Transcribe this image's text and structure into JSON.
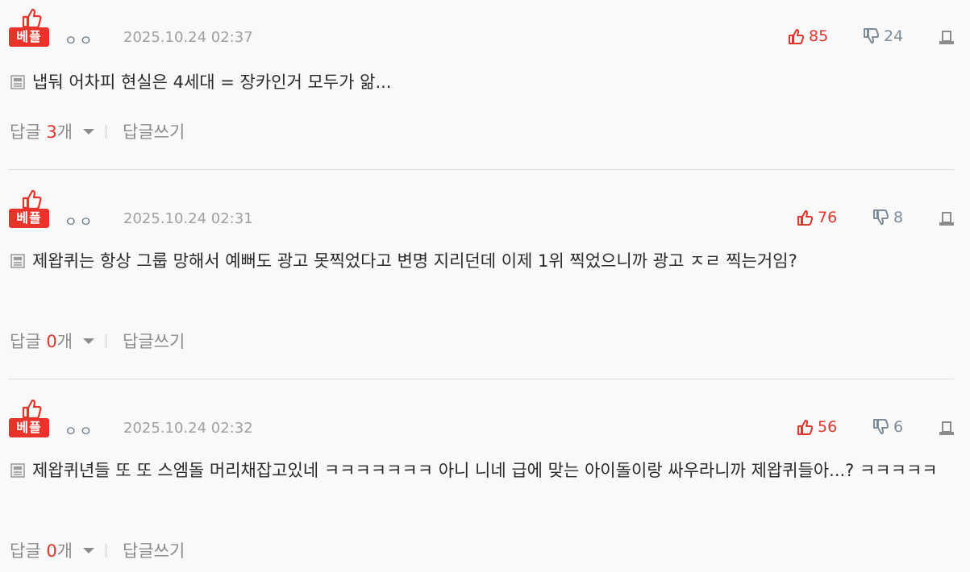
{
  "comments": [
    {
      "badge": "베플",
      "author": "ㅇㅇ",
      "date": "2025.10.24 02:37",
      "likes": "85",
      "dislikes": "24",
      "text": "냅둬 어차피 현실은 4세대 = 장카인거 모두가 앎...",
      "reply_label": "답글",
      "reply_count": "3",
      "reply_unit": "개",
      "write_reply": "답글쓰기"
    },
    {
      "badge": "베플",
      "author": "ㅇㅇ",
      "date": "2025.10.24 02:31",
      "likes": "76",
      "dislikes": "8",
      "text": "제왑퀴는 항상 그룹 망해서 예뻐도 광고 못찍었다고 변명 지리던데 이제 1위 찍었으니까 광고 ㅈㄹ 찍는거임?",
      "reply_label": "답글",
      "reply_count": "0",
      "reply_unit": "개",
      "write_reply": "답글쓰기"
    },
    {
      "badge": "베플",
      "author": "ㅇㅇ",
      "date": "2025.10.24 02:32",
      "likes": "56",
      "dislikes": "6",
      "text": "제왑퀴년들 또 또 스엠돌 머리채잡고있네 ㅋㅋㅋㅋㅋㅋㅋ 아니 니네 급에 맞는 아이돌이랑 싸우라니까 제왑퀴들아...? ㅋㅋㅋㅋㅋ",
      "reply_label": "답글",
      "reply_count": "0",
      "reply_unit": "개",
      "write_reply": "답글쓰기"
    }
  ],
  "icons": {
    "badge_thumb": "thumbs-up-icon",
    "like": "thumbs-up-icon",
    "dislike": "thumbs-down-icon",
    "report": "report-icon",
    "body": "document-icon",
    "replies_toggle": "caret-down-icon"
  },
  "colors": {
    "accent_red": "#e0352b",
    "badge_red": "#e8322a",
    "muted_gray": "#8c8c8c",
    "dislike_gray": "#7d8b98"
  }
}
